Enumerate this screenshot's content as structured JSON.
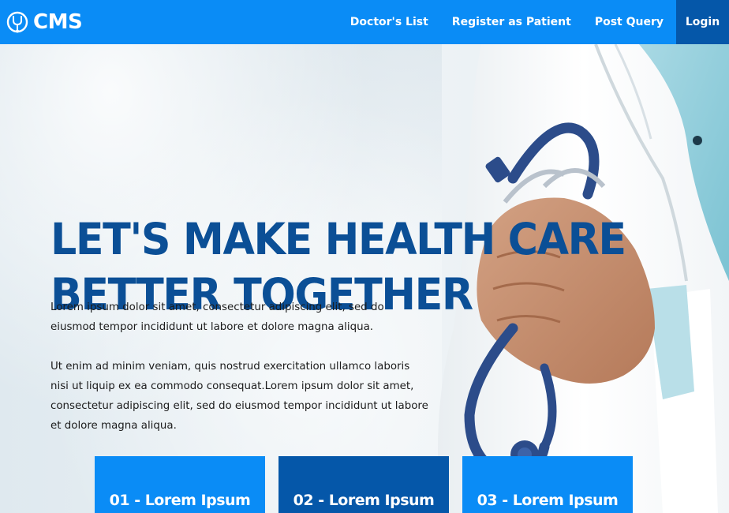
{
  "brand": {
    "name": "CMS",
    "icon": "stethoscope-logo-icon"
  },
  "nav": {
    "items": [
      {
        "label": "Doctor's List"
      },
      {
        "label": "Register as Patient"
      },
      {
        "label": "Post Query"
      },
      {
        "label": "Login"
      }
    ]
  },
  "hero": {
    "title_line1": "LET'S MAKE HEALTH CARE",
    "title_line2": "BETTER TOGETHER",
    "paragraph1": "Lorem ipsum dolor sit amet, consectetur adipiscing elit, sed do eiusmod tempor incididunt ut labore et dolore magna aliqua.",
    "paragraph2": "Ut enim ad minim veniam, quis nostrud exercitation ullamco laboris nisi ut liquip ex ea commodo consequat.Lorem ipsum dolor sit amet, consectetur adipiscing elit, sed do eiusmod tempor incididunt ut labore et dolore magna aliqua."
  },
  "cards": [
    {
      "label": "01 - Lorem Ipsum"
    },
    {
      "label": "02 - Lorem Ipsum"
    },
    {
      "label": "03 - Lorem Ipsum"
    }
  ],
  "colors": {
    "primary": "#0a8cf6",
    "primary_dark": "#0557a9",
    "title": "#0b4f96"
  }
}
